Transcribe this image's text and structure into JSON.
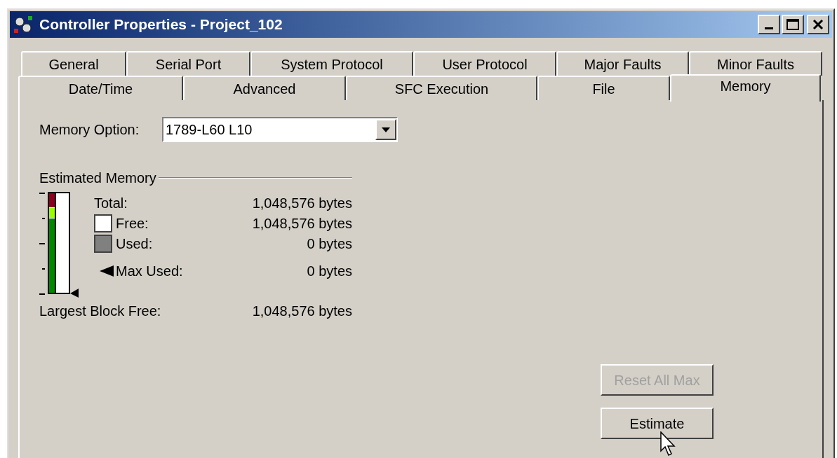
{
  "window": {
    "title": "Controller Properties - Project_102"
  },
  "tab_rows": [
    [
      {
        "label": "General",
        "selected": false
      },
      {
        "label": "Serial Port",
        "selected": false
      },
      {
        "label": "System Protocol",
        "selected": false
      },
      {
        "label": "User Protocol",
        "selected": false
      },
      {
        "label": "Major Faults",
        "selected": false
      },
      {
        "label": "Minor Faults",
        "selected": false
      }
    ],
    [
      {
        "label": "Date/Time",
        "selected": false
      },
      {
        "label": "Advanced",
        "selected": false
      },
      {
        "label": "SFC Execution",
        "selected": false
      },
      {
        "label": "File",
        "selected": false
      },
      {
        "label": "Memory",
        "selected": true
      }
    ]
  ],
  "memory_option": {
    "label": "Memory Option:",
    "value": "1789-L60 L10"
  },
  "estimated_memory": {
    "title": "Estimated Memory",
    "rows": [
      {
        "kind": "plain",
        "label": "Total:",
        "value": "1,048,576 bytes"
      },
      {
        "kind": "swatch",
        "color": "#ffffff",
        "label": "Free:",
        "value": "1,048,576 bytes"
      },
      {
        "kind": "swatch",
        "color": "#808080",
        "label": "Used:",
        "value": "0 bytes"
      },
      {
        "kind": "marker",
        "label": "Max Used:",
        "value": "0 bytes"
      }
    ],
    "largest_block": {
      "label": "Largest Block Free:",
      "value": "1,048,576 bytes"
    }
  },
  "buttons": [
    {
      "label": "Reset All Max",
      "disabled": true
    },
    {
      "label": "Estimate",
      "disabled": false
    }
  ]
}
